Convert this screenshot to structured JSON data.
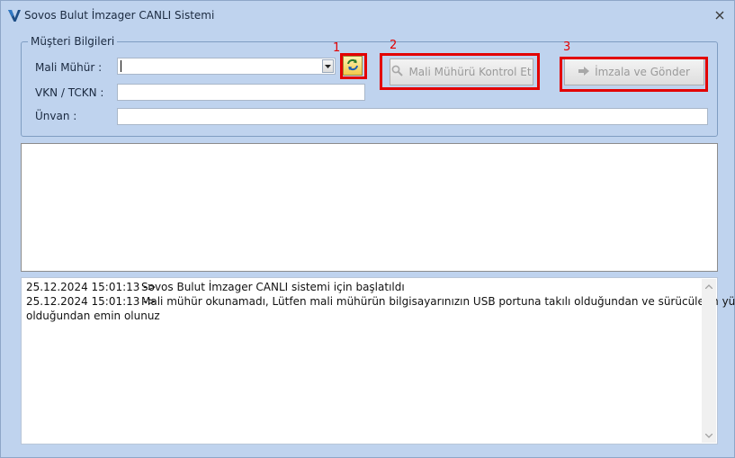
{
  "window": {
    "title": "Sovos Bulut İmzager CANLI Sistemi",
    "logo_icon": "sovos-v-logo-icon",
    "close_icon": "close-icon"
  },
  "customer_group": {
    "legend": "Müşteri Bilgileri",
    "seal_label": "Mali Mühür :",
    "seal_value": "",
    "tax_label": "VKN / TCKN :",
    "tax_value": "",
    "title_label": "Ünvan :",
    "title_value": "",
    "refresh_icon": "refresh-icon"
  },
  "buttons": {
    "check_seal": "Mali Mühürü Kontrol Et",
    "check_icon": "search-icon",
    "sign_send": "İmzala ve Gönder",
    "sign_icon": "arrow-right-icon"
  },
  "callouts": [
    "1",
    "2",
    "3"
  ],
  "log": [
    {
      "time": "25.12.2024 15:01:13 ->",
      "message": "Sovos Bulut İmzager CANLI sistemi için başlatıldı"
    },
    {
      "time": "25.12.2024 15:01:13 ->",
      "message": "Mali mühür okunamadı, Lütfen mali mühürün bilgisayarınızın USB portuna takılı olduğundan ve sürücülerin yüklü"
    },
    {
      "time": "",
      "message": "olduğundan emin olunuz"
    }
  ],
  "colors": {
    "window_bg": "#bfd3ee",
    "callout": "#e30000",
    "disabled_text": "#9a9a9a"
  }
}
